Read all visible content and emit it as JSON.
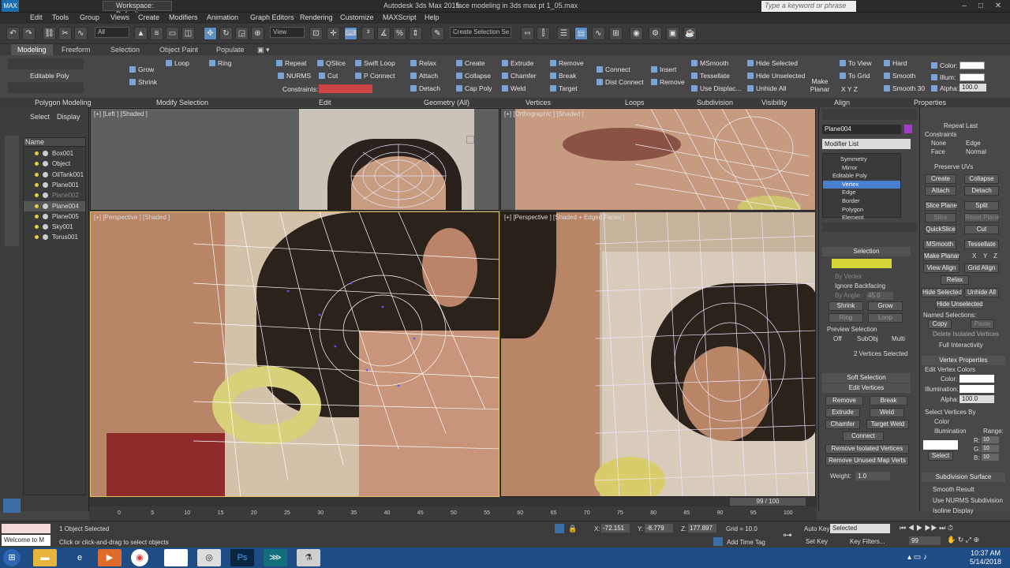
{
  "titlebar": {
    "workspace": "Workspace: Default",
    "app": "Autodesk 3ds Max 2015",
    "file": "face modeling in 3ds max pt 1_05.max",
    "search_placeholder": "Type a keyword or phrase"
  },
  "menu": [
    "Edit",
    "Tools",
    "Group",
    "Views",
    "Create",
    "Modifiers",
    "Animation",
    "Graph Editors",
    "Rendering",
    "Customize",
    "MAXScript",
    "Help"
  ],
  "toolbar": {
    "filter": "All",
    "view": "View",
    "selset": "Create Selection Se"
  },
  "ribbon_tabs": [
    "Modeling",
    "Freeform",
    "Selection",
    "Object Paint",
    "Populate"
  ],
  "ribbon": {
    "editable_poly": "Editable Poly",
    "grow": "Grow",
    "shrink": "Shrink",
    "loop": "Loop",
    "ring": "Ring",
    "repeat": "Repeat",
    "qslice": "QSlice",
    "swift_loop": "Swift Loop",
    "nurms": "NURMS",
    "cut": "Cut",
    "p_connect": "P Connect",
    "constraints": "Constraints:",
    "relax": "Relax",
    "create": "Create",
    "attach": "Attach",
    "collapse": "Collapse",
    "detach": "Detach",
    "cap_poly": "Cap Poly",
    "extrude": "Extrude",
    "remove": "Remove",
    "chamfer": "Chamfer",
    "break": "Break",
    "weld": "Weld",
    "target": "Target",
    "connect": "Connect",
    "dist_connect": "Dist Connect",
    "insert": "Insert",
    "remove2": "Remove",
    "msmooth": "MSmooth",
    "tessellate": "Tessellate",
    "use_displac": "Use Displac...",
    "hide_selected": "Hide Selected",
    "hide_unselected": "Hide Unselected",
    "unhide_all": "Unhide All",
    "make_planar": "Make Planar",
    "to_view": "To View",
    "to_grid": "To Grid",
    "xyz": "X  Y  Z",
    "hard": "Hard",
    "smooth": "Smooth",
    "smooth30": "Smooth 30",
    "color": "Color:",
    "illum": "Illum:",
    "alpha": "Alpha:",
    "alpha_val": "100.0",
    "sections": [
      "Polygon Modeling",
      "Modify Selection",
      "Edit",
      "Geometry (All)",
      "Vertices",
      "Loops",
      "Subdivision",
      "Visibility",
      "Align",
      "Properties"
    ]
  },
  "left": {
    "select": "Select",
    "display": "Display",
    "name_header": "Name",
    "objects": [
      {
        "name": "Box001",
        "state": ""
      },
      {
        "name": "Object",
        "state": ""
      },
      {
        "name": "OilTank001",
        "state": ""
      },
      {
        "name": "Plane001",
        "state": ""
      },
      {
        "name": "Plane002",
        "state": "dim"
      },
      {
        "name": "Plane004",
        "state": "sel"
      },
      {
        "name": "Plane005",
        "state": ""
      },
      {
        "name": "Sky001",
        "state": ""
      },
      {
        "name": "Torus001",
        "state": ""
      }
    ]
  },
  "viewports": {
    "left": "[+] [Left ] [Shaded ]",
    "ortho": "[+] [Orthographic ] [Shaded ]",
    "persp": "[+] [Perspective ] [Shaded ]",
    "persp2": "[+] [Perspective ] [Shaded + Edged Faces ]"
  },
  "modify": {
    "object_name": "Plane004",
    "modifier_list": "Modifier List",
    "stack": [
      "Symmetry",
      "Mirror",
      "Editable Poly",
      "Vertex",
      "Edge",
      "Border",
      "Polygon",
      "Element"
    ],
    "selection": "Selection",
    "by_vertex": "By Vertex",
    "ignore_backfacing": "Ignore Backfacing",
    "by_angle": "By Angle:",
    "angle_val": "45.0",
    "shrink": "Shrink",
    "grow": "Grow",
    "ring": "Ring",
    "loop": "Loop",
    "preview_selection": "Preview Selection",
    "off": "Off",
    "subobj": "SubObj",
    "multi": "Multi",
    "verts_selected": "2 Vertices Selected",
    "soft_selection": "Soft Selection",
    "edit_vertices": "Edit Vertices",
    "remove": "Remove",
    "break": "Break",
    "extrude": "Extrude",
    "weld": "Weld",
    "chamfer": "Chamfer",
    "target_weld": "Target Weld",
    "connect": "Connect",
    "remove_isolated": "Remove Isolated Vertices",
    "remove_unused": "Remove Unused Map Verts",
    "weight": "Weight:",
    "weight_val": "1.0"
  },
  "props": {
    "repeat_last": "Repeat Last",
    "constraints": "Constraints",
    "none": "None",
    "edge": "Edge",
    "face": "Face",
    "normal": "Normal",
    "preserve_uvs": "Preserve UVs",
    "create": "Create",
    "collapse": "Collapse",
    "attach": "Attach",
    "detach": "Detach",
    "slice_plane": "Slice Plane",
    "split": "Split",
    "slice": "Slice",
    "reset_plane": "Reset Plane",
    "quickslice": "QuickSlice",
    "cut": "Cut",
    "msmooth": "MSmooth",
    "tessellate": "Tessellate",
    "make_planar": "Make Planar",
    "x": "X",
    "y": "Y",
    "z": "Z",
    "view_align": "View Align",
    "grid_align": "Grid Align",
    "relax": "Relax",
    "hide_selected": "Hide Selected",
    "unhide_all": "Unhide All",
    "hide_unselected": "Hide Unselected",
    "named_selections": "Named Selections:",
    "copy": "Copy",
    "paste": "Paste",
    "delete_isolated": "Delete Isolated Vertices",
    "full_interactivity": "Full Interactivity",
    "vertex_properties": "Vertex Properties",
    "edit_vertex_colors": "Edit Vertex Colors",
    "color": "Color:",
    "illumination": "Illumination:",
    "alpha": "Alpha:",
    "alpha_val": "100.0",
    "select_vertices_by": "Select Vertices By",
    "color_opt": "Color",
    "illum_opt": "Illumination",
    "range": "Range:",
    "r": "R:",
    "g": "G:",
    "b": "B:",
    "r_val": "10",
    "g_val": "10",
    "b_val": "10",
    "select": "Select",
    "subdivision_surface": "Subdivision Surface",
    "smooth_result": "Smooth Result",
    "use_nurms": "Use NURMS Subdivision",
    "isoline_display": "Isoline Display"
  },
  "timeline": {
    "frame": "99 / 100",
    "ticks": [
      "0",
      "5",
      "10",
      "15",
      "20",
      "25",
      "30",
      "35",
      "40",
      "45",
      "50",
      "55",
      "60",
      "65",
      "70",
      "75",
      "80",
      "85",
      "90",
      "95",
      "100"
    ]
  },
  "status": {
    "objects_selected": "1 Object Selected",
    "prompt": "Click or click-and-drag to select objects",
    "welcome": "Welcome to M",
    "x_label": "X:",
    "x": "-72.151",
    "y_label": "Y:",
    "y": "-8.779",
    "z_label": "Z:",
    "z": "177.897",
    "grid": "Grid = 10.0",
    "add_time_tag": "Add Time Tag",
    "auto_key": "Auto Key",
    "set_key": "Set Key",
    "key_filters": "Key Filters...",
    "selected": "Selected",
    "frame_val": "99"
  },
  "taskbar": {
    "time": "10:37 AM",
    "date": "5/14/2018"
  }
}
